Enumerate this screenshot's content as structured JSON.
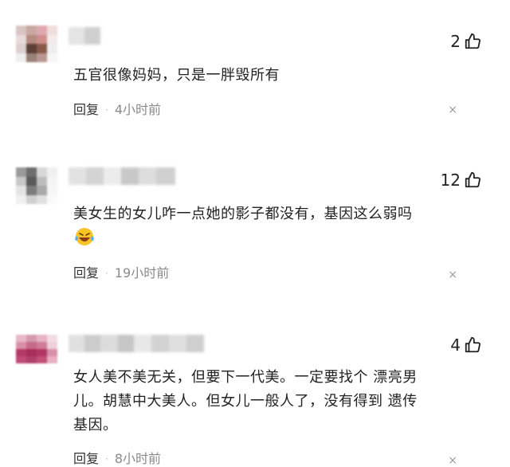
{
  "comments": [
    {
      "likes": "2",
      "text": "五官很像妈妈，只是一胖毁所有",
      "reply": "回复",
      "dot": "·",
      "time": "4小时前",
      "close": "×",
      "has_emoji": false
    },
    {
      "likes": "12",
      "text": "美女生的女儿咋一点她的影子都没有，基因这么弱吗",
      "reply": "回复",
      "dot": "·",
      "time": "19小时前",
      "close": "×",
      "has_emoji": true,
      "emoji_icon": "laughing-crying-face-icon"
    },
    {
      "likes": "4",
      "text_lines": [
        "女人美不美无关，但要下一代美。一定要找个 漂亮男",
        "儿。胡慧中大美人。但女儿一般人了，没有得到 遗传",
        "基因。"
      ],
      "reply": "回复",
      "dot": "·",
      "time": "8小时前",
      "close": "×",
      "has_emoji": false
    }
  ],
  "colors": {
    "text": "#222222",
    "meta": "#8a8a8a",
    "avatar1": [
      "#8c6b5d",
      "#c9a090",
      "#d9a8a8",
      "#5d3f35"
    ],
    "avatar2": [
      "#7a7a7a",
      "#b0b0b0",
      "#d0d0d0",
      "#4f4f4f"
    ],
    "avatar3": [
      "#c65a7a",
      "#e8b0c0",
      "#d9a0b0",
      "#a83058"
    ]
  }
}
